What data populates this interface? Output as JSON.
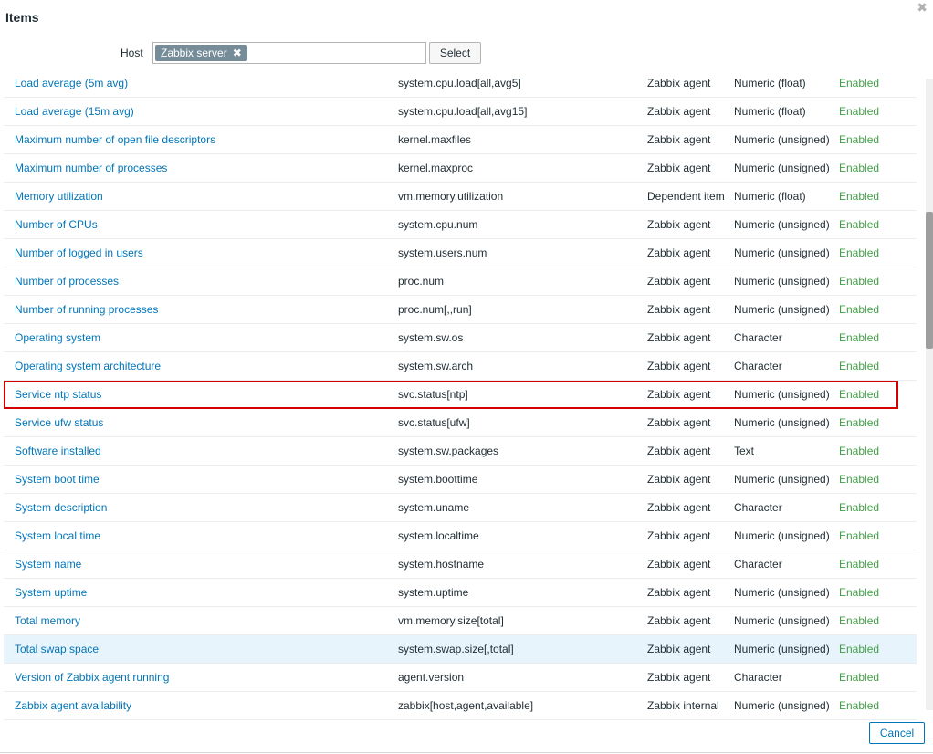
{
  "dialog": {
    "title": "Items",
    "close_icon": "close-icon"
  },
  "filter": {
    "host_label": "Host",
    "host_tag": "Zabbix server",
    "select_label": "Select"
  },
  "footer": {
    "cancel_label": "Cancel"
  },
  "colors": {
    "link": "#0275b8",
    "enabled": "#429e47",
    "selected_border": "#d40000",
    "hover_row": "#e8f4fb"
  },
  "rows": [
    {
      "name": "Load average (5m avg)",
      "key": "system.cpu.load[all,avg5]",
      "type": "Zabbix agent",
      "info": "Numeric (float)",
      "status": "Enabled"
    },
    {
      "name": "Load average (15m avg)",
      "key": "system.cpu.load[all,avg15]",
      "type": "Zabbix agent",
      "info": "Numeric (float)",
      "status": "Enabled"
    },
    {
      "name": "Maximum number of open file descriptors",
      "key": "kernel.maxfiles",
      "type": "Zabbix agent",
      "info": "Numeric (unsigned)",
      "status": "Enabled"
    },
    {
      "name": "Maximum number of processes",
      "key": "kernel.maxproc",
      "type": "Zabbix agent",
      "info": "Numeric (unsigned)",
      "status": "Enabled"
    },
    {
      "name": "Memory utilization",
      "key": "vm.memory.utilization",
      "type": "Dependent item",
      "info": "Numeric (float)",
      "status": "Enabled"
    },
    {
      "name": "Number of CPUs",
      "key": "system.cpu.num",
      "type": "Zabbix agent",
      "info": "Numeric (unsigned)",
      "status": "Enabled"
    },
    {
      "name": "Number of logged in users",
      "key": "system.users.num",
      "type": "Zabbix agent",
      "info": "Numeric (unsigned)",
      "status": "Enabled"
    },
    {
      "name": "Number of processes",
      "key": "proc.num",
      "type": "Zabbix agent",
      "info": "Numeric (unsigned)",
      "status": "Enabled"
    },
    {
      "name": "Number of running processes",
      "key": "proc.num[,,run]",
      "type": "Zabbix agent",
      "info": "Numeric (unsigned)",
      "status": "Enabled"
    },
    {
      "name": "Operating system",
      "key": "system.sw.os",
      "type": "Zabbix agent",
      "info": "Character",
      "status": "Enabled"
    },
    {
      "name": "Operating system architecture",
      "key": "system.sw.arch",
      "type": "Zabbix agent",
      "info": "Character",
      "status": "Enabled"
    },
    {
      "name": "Service ntp status",
      "key": "svc.status[ntp]",
      "type": "Zabbix agent",
      "info": "Numeric (unsigned)",
      "status": "Enabled"
    },
    {
      "name": "Service ufw status",
      "key": "svc.status[ufw]",
      "type": "Zabbix agent",
      "info": "Numeric (unsigned)",
      "status": "Enabled"
    },
    {
      "name": "Software installed",
      "key": "system.sw.packages",
      "type": "Zabbix agent",
      "info": "Text",
      "status": "Enabled"
    },
    {
      "name": "System boot time",
      "key": "system.boottime",
      "type": "Zabbix agent",
      "info": "Numeric (unsigned)",
      "status": "Enabled"
    },
    {
      "name": "System description",
      "key": "system.uname",
      "type": "Zabbix agent",
      "info": "Character",
      "status": "Enabled"
    },
    {
      "name": "System local time",
      "key": "system.localtime",
      "type": "Zabbix agent",
      "info": "Numeric (unsigned)",
      "status": "Enabled"
    },
    {
      "name": "System name",
      "key": "system.hostname",
      "type": "Zabbix agent",
      "info": "Character",
      "status": "Enabled"
    },
    {
      "name": "System uptime",
      "key": "system.uptime",
      "type": "Zabbix agent",
      "info": "Numeric (unsigned)",
      "status": "Enabled"
    },
    {
      "name": "Total memory",
      "key": "vm.memory.size[total]",
      "type": "Zabbix agent",
      "info": "Numeric (unsigned)",
      "status": "Enabled"
    },
    {
      "name": "Total swap space",
      "key": "system.swap.size[,total]",
      "type": "Zabbix agent",
      "info": "Numeric (unsigned)",
      "status": "Enabled"
    },
    {
      "name": "Version of Zabbix agent running",
      "key": "agent.version",
      "type": "Zabbix agent",
      "info": "Character",
      "status": "Enabled"
    },
    {
      "name": "Zabbix agent availability",
      "key": "zabbix[host,agent,available]",
      "type": "Zabbix internal",
      "info": "Numeric (unsigned)",
      "status": "Enabled"
    }
  ]
}
